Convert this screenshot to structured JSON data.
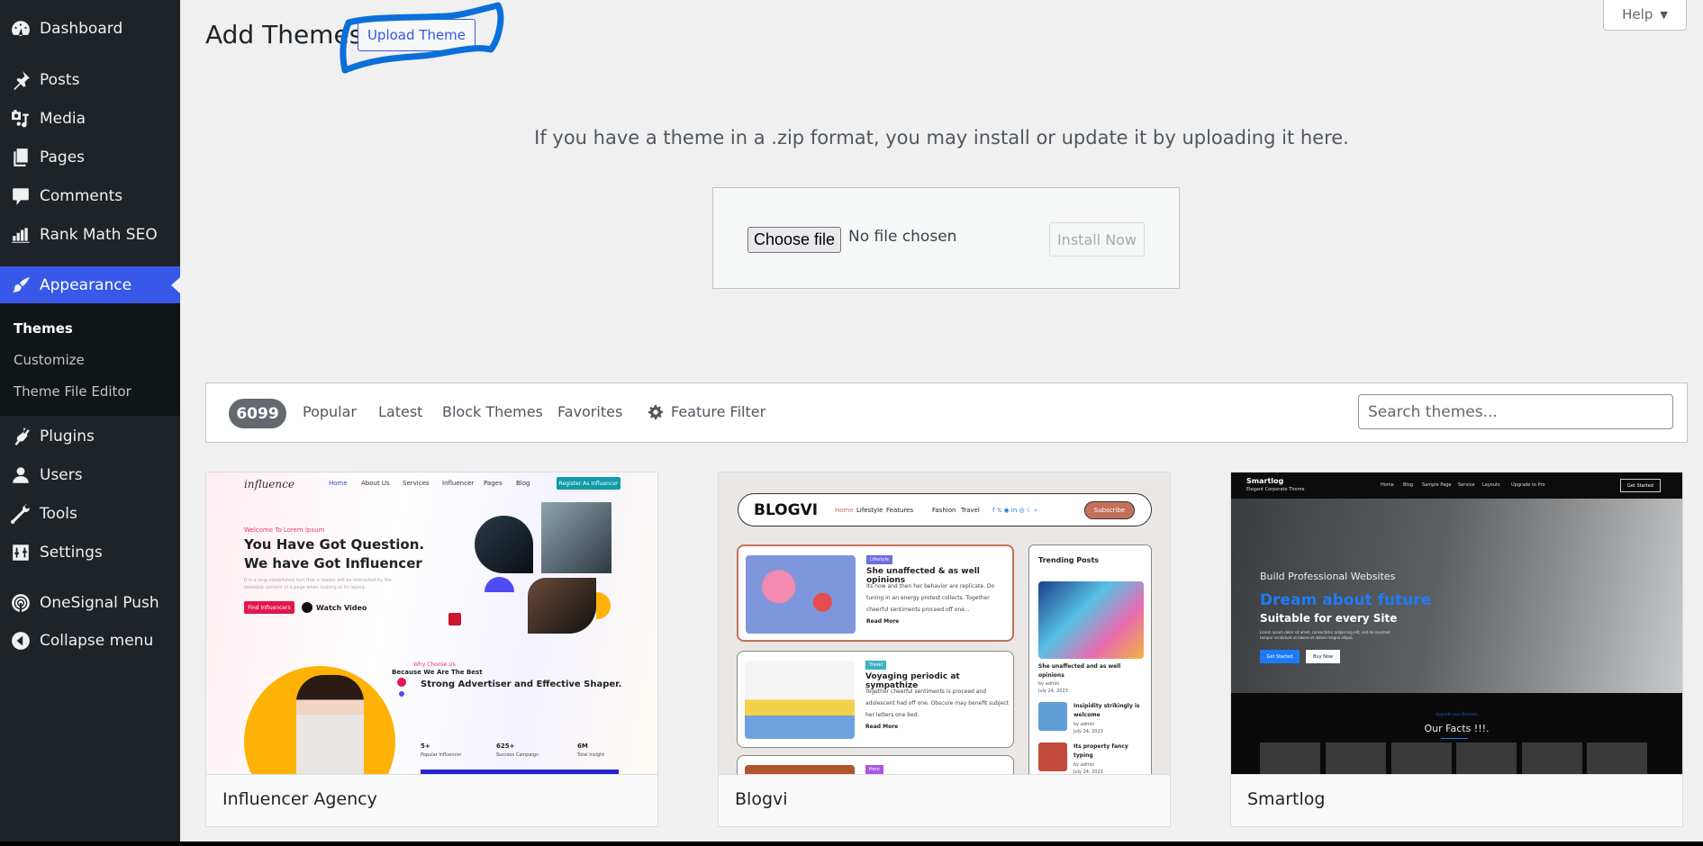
{
  "sidebar": {
    "items": [
      {
        "label": "Dashboard",
        "icon": "dashboard-icon"
      },
      {
        "label": "Posts",
        "icon": "pushpin-icon"
      },
      {
        "label": "Media",
        "icon": "media-icon"
      },
      {
        "label": "Pages",
        "icon": "pages-icon"
      },
      {
        "label": "Comments",
        "icon": "comment-icon"
      },
      {
        "label": "Rank Math SEO",
        "icon": "rank-math-icon"
      },
      {
        "label": "Appearance",
        "icon": "paintbrush-icon",
        "active": true
      },
      {
        "label": "Plugins",
        "icon": "plug-icon"
      },
      {
        "label": "Users",
        "icon": "user-icon"
      },
      {
        "label": "Tools",
        "icon": "wrench-icon"
      },
      {
        "label": "Settings",
        "icon": "settings-sliders-icon"
      },
      {
        "label": "OneSignal Push",
        "icon": "onesignal-icon"
      },
      {
        "label": "Collapse menu",
        "icon": "collapse-arrow-icon"
      }
    ],
    "submenu": [
      {
        "label": "Themes",
        "current": true
      },
      {
        "label": "Customize"
      },
      {
        "label": "Theme File Editor"
      }
    ]
  },
  "header": {
    "title": "Add Themes",
    "upload_button": "Upload Theme",
    "help_button": "Help"
  },
  "upload": {
    "description": "If you have a theme in a .zip format, you may install or update it by uploading it here.",
    "choose_file": "Choose file",
    "no_file": "No file chosen",
    "install_button": "Install Now"
  },
  "filters": {
    "count": "6099",
    "links": [
      "Popular",
      "Latest",
      "Block Themes",
      "Favorites"
    ],
    "feature_filter": "Feature Filter",
    "search_placeholder": "Search themes..."
  },
  "themes": [
    {
      "name": "Influencer Agency",
      "preview": {
        "logo": "influence",
        "nav": [
          "Home",
          "About Us",
          "Services",
          "Influencer",
          "Pages",
          "Blog"
        ],
        "cta": "Register As Influencer",
        "welcome": "Welcome To Lorem Ipsum",
        "headline": "You Have Got Question. We have Got Influencer",
        "paragraph": "It is a long established fact that a reader will be distracted by the readable content of a page when looking at its layout.",
        "find": "Find Influencers",
        "watch": "Watch Video",
        "why": "Why Choose Us",
        "because": "Because We Are The Best",
        "strong": "Strong Advertiser and Effective Shaper.",
        "stats": [
          {
            "value": "5+",
            "label": "Popular Influencer"
          },
          {
            "value": "625+",
            "label": "Success Campaign"
          },
          {
            "value": "6M",
            "label": "Total Insight"
          }
        ]
      }
    },
    {
      "name": "Blogvi",
      "preview": {
        "brand": "BLOGVI",
        "nav": [
          "Home",
          "Lifestyle",
          "Features",
          "Fashion",
          "Travel"
        ],
        "subscribe": "Subscribe",
        "posts": [
          {
            "tag": "Lifestyle",
            "title": "She unaffected & as well opinions",
            "text": "Its now and then her behavior are replicate. Do tuning in an energy protest collects. Together cheerful sentiments proceed off one...",
            "more": "Read More"
          },
          {
            "tag": "Travel",
            "title": "Voyaging periodic at sympathize",
            "text": "Together cheerful sentiments is proceed and adolescent had off one. Obscure may benefit subject her letters one bed.",
            "more": "Read More"
          },
          {
            "tag": "Hero"
          }
        ],
        "sidebar_title": "Trending Posts",
        "trending": [
          {
            "title": "She unaffected and as well opinions",
            "by": "by admin",
            "date": "July 24, 2023"
          },
          {
            "title": "Insipidity strikingly is welcome",
            "by": "by admin",
            "date": "July 24, 2023"
          },
          {
            "title": "Its property fancy typing",
            "by": "by admin",
            "date": "July 24, 2023"
          }
        ]
      }
    },
    {
      "name": "Smartlog",
      "preview": {
        "site": "Smartlog",
        "tagline": "Elegant Corporate Theme",
        "nav": [
          "Home",
          "Blog",
          "Sample Page",
          "Service",
          "Layouts",
          "Upgrade to Pro"
        ],
        "get_started": "Get Started",
        "build": "Build Professional Websites",
        "dream": "Dream about future",
        "suitable": "Suitable for every Site",
        "lorem": "Lorem ipsum dolor sit amet, consectetur adipiscing elit, sed do eiusmod tempor incididunt ut labore et dolore magna aliqua.",
        "buy": "Buy Now",
        "upgrade": "Upgrade your Business",
        "facts": "Our Facts !!!."
      }
    }
  ],
  "colors": {
    "accent": "#3858e9",
    "sidebar_bg": "#1d2327",
    "annotation_stroke": "#0a6fd8"
  }
}
